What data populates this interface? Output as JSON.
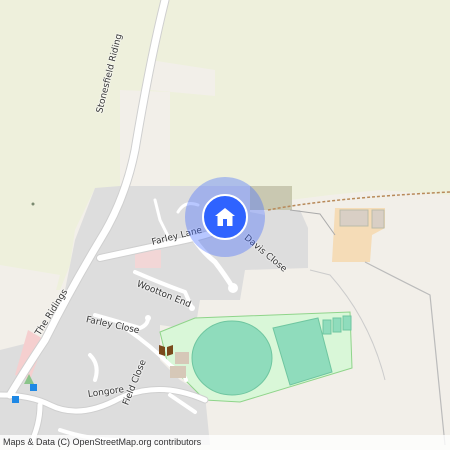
{
  "map": {
    "colors": {
      "farmland": "#eef0dc",
      "background": "#f2efe9",
      "residential": "#dddddd",
      "road": "#ffffff",
      "park": "#d9f7d8",
      "pitch": "#8fdcbc",
      "building": "#d6c8b8",
      "track": "#b88a5a",
      "marker": "#2f63ff"
    },
    "streets": {
      "stonesfield_riding": "Stonesfield Riding",
      "farley_lane": "Farley Lane",
      "davis_close": "Davis Close",
      "wootton_end": "Wootton End",
      "the_ridings": "The Ridings",
      "farley_close": "Farley Close",
      "longore": "Longore",
      "field_close": "Field Close"
    },
    "marker_icon": "home-icon",
    "attribution": "Maps & Data (C) OpenStreetMap.org contributors"
  }
}
